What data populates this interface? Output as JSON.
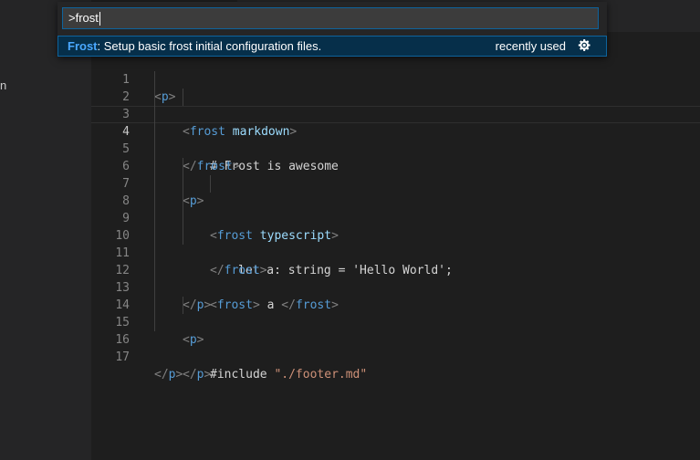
{
  "sidebar": {
    "visible_fragment": "n"
  },
  "command_palette": {
    "input_value": ">frost",
    "result": {
      "highlight": "Frost",
      "rest": ": Setup basic frost initial configuration files.",
      "badge": "recently used",
      "action_icon": "gear-icon"
    }
  },
  "editor": {
    "lines": [
      {
        "num": "1"
      },
      {
        "num": "2"
      },
      {
        "num": "3"
      },
      {
        "num": "4"
      },
      {
        "num": "5"
      },
      {
        "num": "6"
      },
      {
        "num": "7"
      },
      {
        "num": "8"
      },
      {
        "num": "9"
      },
      {
        "num": "10"
      },
      {
        "num": "11"
      },
      {
        "num": "12"
      },
      {
        "num": "13"
      },
      {
        "num": "14"
      },
      {
        "num": "15"
      },
      {
        "num": "16"
      },
      {
        "num": "17"
      }
    ],
    "tokens": {
      "l1": [
        "<",
        "p",
        ">"
      ],
      "l2": [
        "<",
        "frost",
        " ",
        "markdown",
        ">"
      ],
      "l3": "# Frost is awesome",
      "l4": [
        "</",
        "frost",
        ">"
      ],
      "l6": [
        "<",
        "p",
        ">"
      ],
      "l7": [
        "<",
        "frost",
        " ",
        "typescript",
        ">"
      ],
      "l8": "let a: string = 'Hello World';",
      "l9": [
        "</",
        "frost",
        ">"
      ],
      "l11": [
        "<",
        "frost",
        ">",
        " a ",
        "</",
        "frost",
        ">"
      ],
      "l12": [
        "</",
        "p",
        ">"
      ],
      "l14": [
        "<",
        "p",
        ">"
      ],
      "l15": [
        "#include ",
        "\"./footer.md\""
      ],
      "l16": [
        "</",
        "p",
        ">"
      ],
      "l17": [
        "</",
        "p",
        ">"
      ]
    }
  }
}
